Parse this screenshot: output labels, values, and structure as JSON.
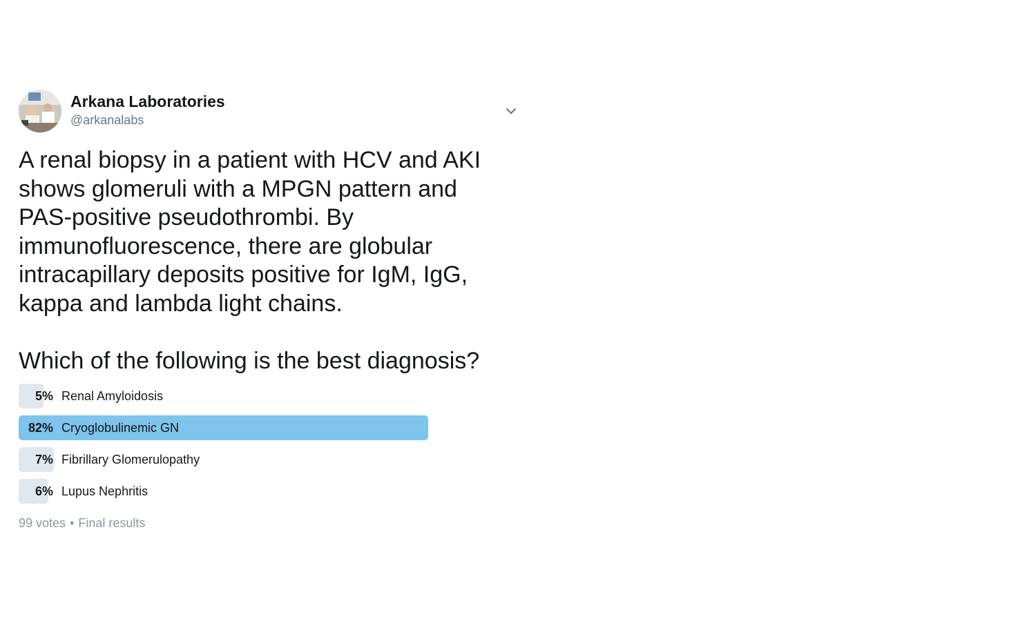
{
  "tweet": {
    "display_name": "Arkana Laboratories",
    "handle": "@arkanalabs",
    "avatar_icon": "lab-photo-avatar",
    "caret_icon": "chevron-down-icon",
    "text": "A renal biopsy in a patient with HCV and AKI\nshows glomeruli with a MPGN pattern and\nPAS-positive pseudothrombi. By\nimmunofluorescence, there are globular\nintracapillary deposits positive for IgM, IgG,\nkappa and lambda light chains.\n\nWhich of the following is the best diagnosis?"
  },
  "poll": {
    "bar_color": "#e1e8ed",
    "winner_color": "#7fc4ec",
    "options": [
      {
        "percent_label": "5%",
        "percent": 5,
        "label": "Renal Amyloidosis",
        "winner": false
      },
      {
        "percent_label": "82%",
        "percent": 82,
        "label": "Cryoglobulinemic GN",
        "winner": true
      },
      {
        "percent_label": "7%",
        "percent": 7,
        "label": "Fibrillary Glomerulopathy",
        "winner": false
      },
      {
        "percent_label": "6%",
        "percent": 6,
        "label": "Lupus Nephritis",
        "winner": false
      }
    ],
    "votes": "99 votes",
    "separator": "•",
    "status": "Final results"
  }
}
